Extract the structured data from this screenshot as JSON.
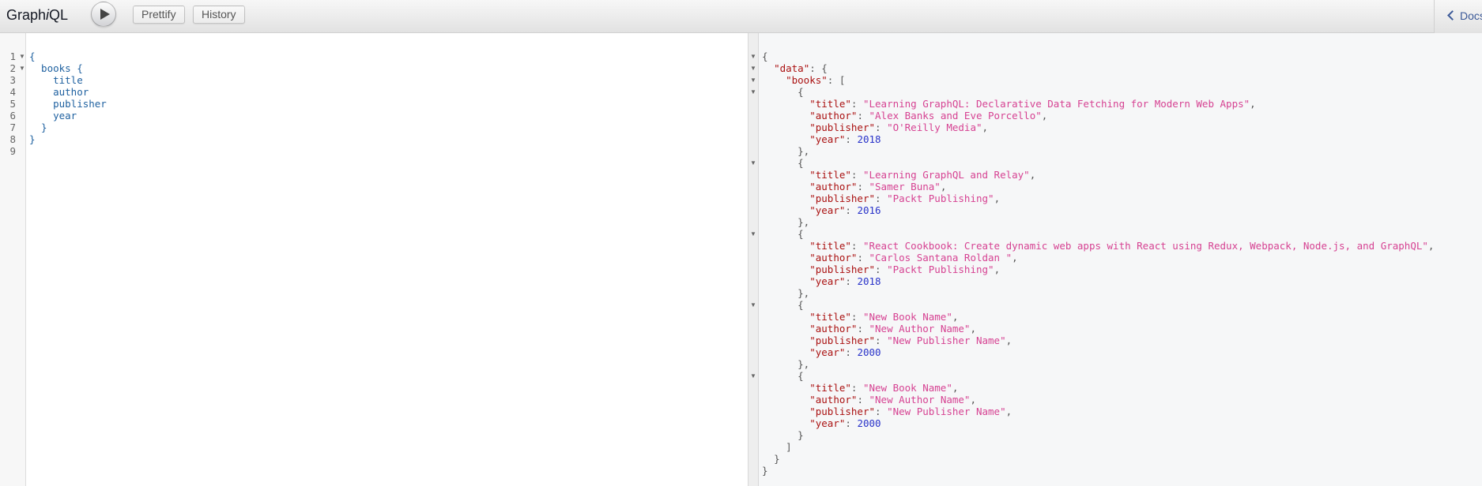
{
  "header": {
    "title_part1": "Graph",
    "title_part2": "i",
    "title_part3": "QL",
    "prettify_label": "Prettify",
    "history_label": "History",
    "docs_label": "Docs"
  },
  "query_editor": {
    "line_numbers": [
      "1",
      "2",
      "3",
      "4",
      "5",
      "6",
      "7",
      "8",
      "9"
    ],
    "lines": [
      "{",
      "  books {",
      "    title",
      "    author",
      "    publisher",
      "    year",
      "  }",
      "}",
      ""
    ]
  },
  "result": {
    "books": [
      {
        "title": "Learning GraphQL: Declarative Data Fetching for Modern Web Apps",
        "author": "Alex Banks and Eve Porcello",
        "publisher": "O'Reilly Media",
        "year": "2018"
      },
      {
        "title": "Learning GraphQL and Relay",
        "author": "Samer Buna",
        "publisher": "Packt Publishing",
        "year": "2016"
      },
      {
        "title": "React Cookbook: Create dynamic web apps with React using Redux, Webpack, Node.js, and GraphQL",
        "author": "Carlos Santana Roldan ",
        "publisher": "Packt Publishing",
        "year": "2018"
      },
      {
        "title": "New Book Name",
        "author": "New Author Name",
        "publisher": "New Publisher Name",
        "year": "2000"
      },
      {
        "title": "New Book Name",
        "author": "New Author Name",
        "publisher": "New Publisher Name",
        "year": "2000"
      }
    ]
  },
  "colors": {
    "field": "#1f61a0",
    "json_key": "#aa1111",
    "json_string": "#d64292",
    "json_number": "#2933c9",
    "docs_link": "#3b5998"
  }
}
